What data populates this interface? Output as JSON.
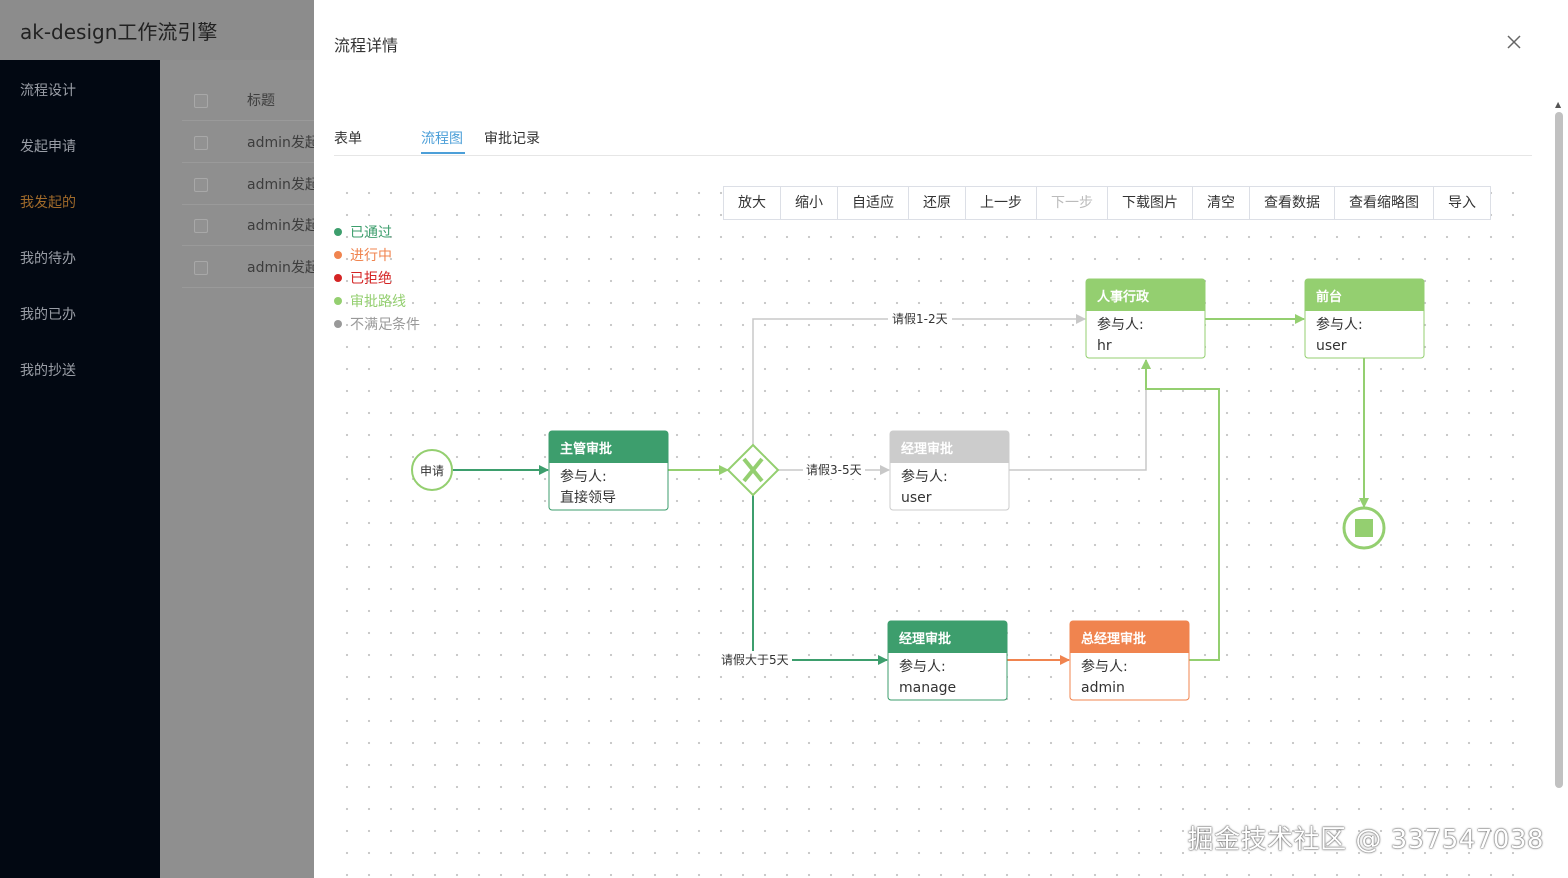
{
  "app": {
    "title": "ak-design工作流引擎",
    "menu": [
      "流程设计",
      "发起申请",
      "我发起的",
      "我的待办",
      "我的已办",
      "我的抄送"
    ],
    "active_menu": "我发起的",
    "table_header": "标题",
    "rows": [
      "admin发起",
      "admin发起",
      "admin发起",
      "admin发起"
    ]
  },
  "drawer": {
    "title": "流程详情",
    "tabs": [
      "表单",
      "流程图",
      "审批记录"
    ],
    "active_tab": "流程图"
  },
  "toolbar": [
    "放大",
    "缩小",
    "自适应",
    "还原",
    "上一步",
    "下一步",
    "下载图片",
    "清空",
    "查看数据",
    "查看缩略图",
    "导入"
  ],
  "toolbar_disabled": [
    "下一步"
  ],
  "legend": [
    {
      "label": "已通过",
      "color": "#3d9e6d"
    },
    {
      "label": "进行中",
      "color": "#f0844f"
    },
    {
      "label": "已拒绝",
      "color": "#d42424"
    },
    {
      "label": "审批路线",
      "color": "#94cf70"
    },
    {
      "label": "不满足条件",
      "color": "#999999"
    }
  ],
  "flow": {
    "start": {
      "label": "申请"
    },
    "nodes": {
      "supervisor": {
        "title": "主管审批",
        "line1": "参与人:",
        "line2": "直接领导",
        "color": "#3d9e6d"
      },
      "manager_mid": {
        "title": "经理审批",
        "line1": "参与人:",
        "line2": "user",
        "color": "#cccccc"
      },
      "hr": {
        "title": "人事行政",
        "line1": "参与人:",
        "line2": "hr",
        "color": "#94cf70"
      },
      "front": {
        "title": "前台",
        "line1": "参与人:",
        "line2": "user",
        "color": "#94cf70"
      },
      "manager_low": {
        "title": "经理审批",
        "line1": "参与人:",
        "line2": "manage",
        "color": "#3d9e6d"
      },
      "gm": {
        "title": "总经理审批",
        "line1": "参与人:",
        "line2": "admin",
        "color": "#f0844f"
      }
    },
    "edges": {
      "to_hr": "请假1-2天",
      "to_manager_mid": "请假3-5天",
      "to_manager_low": "请假大于5天"
    }
  },
  "watermark": "掘金技术社区 @ 337547038"
}
